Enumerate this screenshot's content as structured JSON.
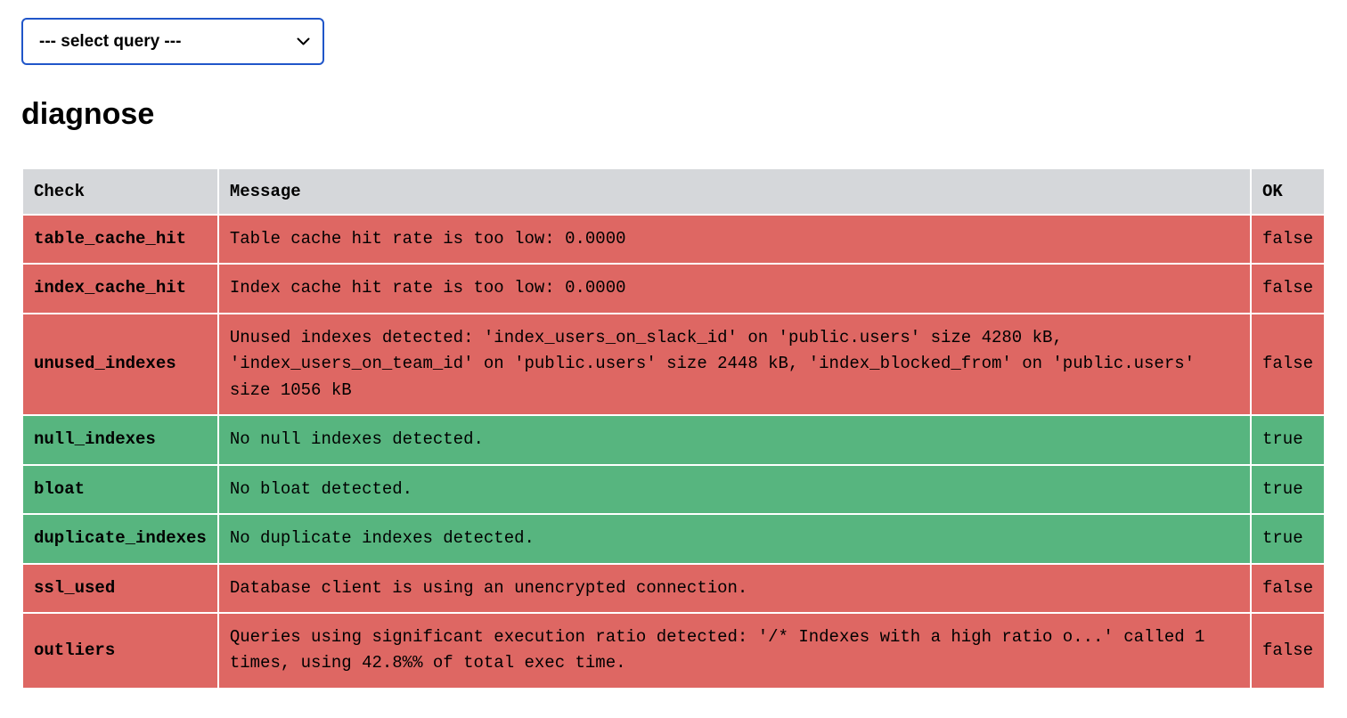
{
  "select": {
    "placeholder": "--- select query ---"
  },
  "title": "diagnose",
  "columns": {
    "check": "Check",
    "message": "Message",
    "ok": "OK"
  },
  "rows": [
    {
      "check": "table_cache_hit",
      "message": "Table cache hit rate is too low: 0.0000",
      "ok": "false",
      "status": "false"
    },
    {
      "check": "index_cache_hit",
      "message": "Index cache hit rate is too low: 0.0000",
      "ok": "false",
      "status": "false"
    },
    {
      "check": "unused_indexes",
      "message": "Unused indexes detected: 'index_users_on_slack_id' on 'public.users' size 4280 kB, 'index_users_on_team_id' on 'public.users' size 2448 kB, 'index_blocked_from' on 'public.users' size 1056 kB",
      "ok": "false",
      "status": "false"
    },
    {
      "check": "null_indexes",
      "message": "No null indexes detected.",
      "ok": "true",
      "status": "true"
    },
    {
      "check": "bloat",
      "message": "No bloat detected.",
      "ok": "true",
      "status": "true"
    },
    {
      "check": "duplicate_indexes",
      "message": "No duplicate indexes detected.",
      "ok": "true",
      "status": "true"
    },
    {
      "check": "ssl_used",
      "message": "Database client is using an unencrypted connection.",
      "ok": "false",
      "status": "false"
    },
    {
      "check": "outliers",
      "message": "Queries using significant execution ratio detected: '/* Indexes with a high ratio o...' called 1 times, using 42.8%% of total exec time.",
      "ok": "false",
      "status": "false"
    }
  ]
}
